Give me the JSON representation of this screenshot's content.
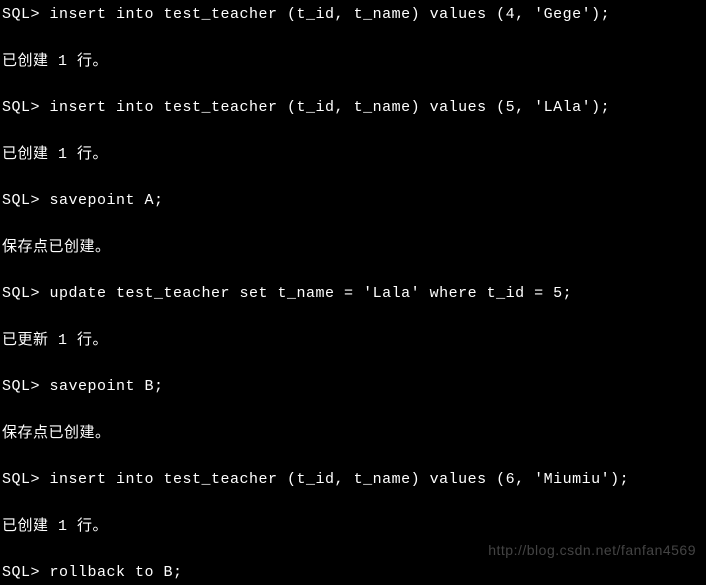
{
  "terminal": {
    "lines": [
      {
        "prompt": "SQL> ",
        "command": "insert into test_teacher (t_id, t_name) values (4, 'Gege');"
      },
      {
        "blank": true
      },
      {
        "output": "已创建 1 行。"
      },
      {
        "blank": true
      },
      {
        "prompt": "SQL> ",
        "command": "insert into test_teacher (t_id, t_name) values (5, 'LAla');"
      },
      {
        "blank": true
      },
      {
        "output": "已创建 1 行。"
      },
      {
        "blank": true
      },
      {
        "prompt": "SQL> ",
        "command": "savepoint A;"
      },
      {
        "blank": true
      },
      {
        "output": "保存点已创建。"
      },
      {
        "blank": true
      },
      {
        "prompt": "SQL> ",
        "command": "update test_teacher set t_name = 'Lala' where t_id = 5;"
      },
      {
        "blank": true
      },
      {
        "output": "已更新 1 行。"
      },
      {
        "blank": true
      },
      {
        "prompt": "SQL> ",
        "command": "savepoint B;"
      },
      {
        "blank": true
      },
      {
        "output": "保存点已创建。"
      },
      {
        "blank": true
      },
      {
        "prompt": "SQL> ",
        "command": "insert into test_teacher (t_id, t_name) values (6, 'Miumiu');"
      },
      {
        "blank": true
      },
      {
        "output": "已创建 1 行。"
      },
      {
        "blank": true
      },
      {
        "prompt": "SQL> ",
        "command": "rollback to B;"
      }
    ]
  },
  "watermark": "http://blog.csdn.net/fanfan4569"
}
